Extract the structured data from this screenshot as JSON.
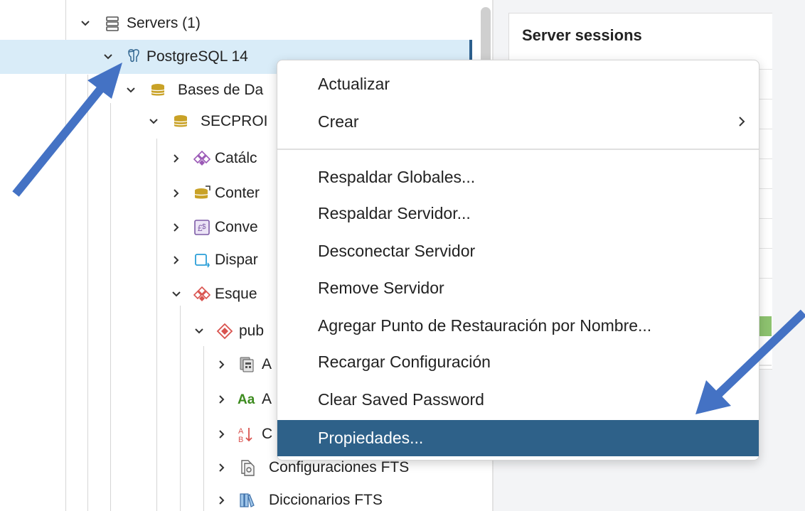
{
  "tree": {
    "items": [
      {
        "label": "Servers (1)",
        "expanded": true,
        "icon": "servers-icon"
      },
      {
        "label": "PostgreSQL 14",
        "expanded": true,
        "icon": "postgresql-elephant-icon",
        "selected": true
      },
      {
        "label": "Bases de Da",
        "expanded": true,
        "icon": "databases-icon"
      },
      {
        "label": "SECPROI",
        "expanded": true,
        "icon": "database-icon"
      },
      {
        "label": "Catálc",
        "expanded": false,
        "icon": "catalogs-icon"
      },
      {
        "label": "Conter",
        "expanded": false,
        "icon": "extensions-icon"
      },
      {
        "label": "Conve",
        "expanded": false,
        "icon": "foreign-data-wrappers-icon"
      },
      {
        "label": "Dispar",
        "expanded": false,
        "icon": "event-triggers-icon"
      },
      {
        "label": "Esque",
        "expanded": true,
        "icon": "schemas-icon"
      },
      {
        "label": "pub",
        "expanded": true,
        "icon": "schema-public-icon"
      },
      {
        "label": "A",
        "expanded": false,
        "icon": "aggregates-icon"
      },
      {
        "label": "A",
        "expanded": false,
        "icon": "collations-icon",
        "icon_text": "Aa"
      },
      {
        "label": "C",
        "expanded": false,
        "icon": "sort-az-icon"
      },
      {
        "label": "Configuraciones FTS",
        "expanded": false,
        "icon": "fts-configurations-icon"
      },
      {
        "label": "Diccionarios FTS",
        "expanded": false,
        "icon": "fts-dictionaries-icon"
      }
    ]
  },
  "right_panel": {
    "title": "Server sessions",
    "accent_color": "#8dc26f"
  },
  "context_menu": {
    "items": [
      {
        "label": "Actualizar"
      },
      {
        "label": "Crear",
        "has_submenu": true
      }
    ],
    "items2": [
      {
        "label": "Respaldar Globales..."
      },
      {
        "label": "Respaldar Servidor..."
      },
      {
        "label": "Desconectar Servidor"
      },
      {
        "label": "Remove Servidor"
      },
      {
        "label": "Agregar Punto de Restauración por Nombre..."
      },
      {
        "label": "Recargar Configuración"
      },
      {
        "label": "Clear Saved Password"
      },
      {
        "label": "Propiedades...",
        "active": true
      }
    ],
    "active_color": "#2e6189"
  },
  "annotations": {
    "arrow_color": "#4472c4",
    "arrows": [
      "arrow-to-postgresql",
      "arrow-to-propiedades"
    ]
  }
}
